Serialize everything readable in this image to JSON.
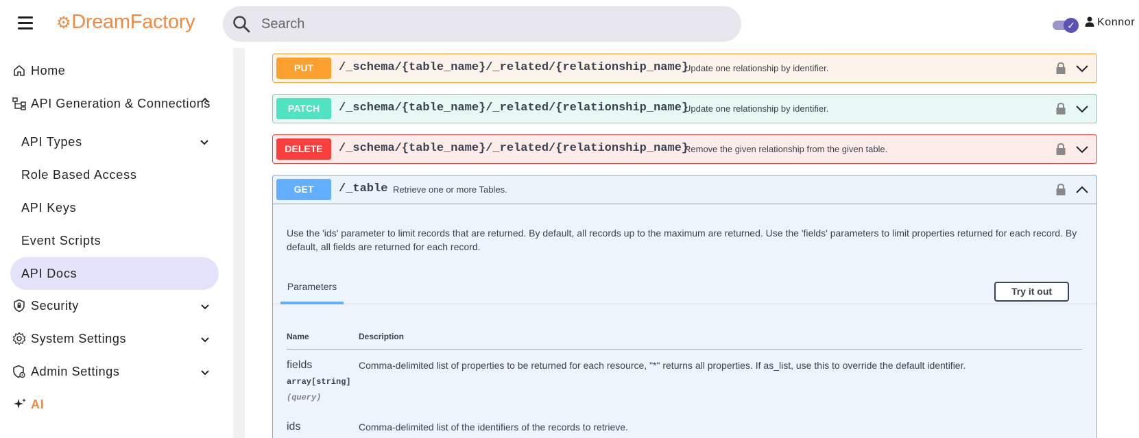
{
  "header": {
    "logo": "DreamFactory",
    "search_placeholder": "Search",
    "user_name": "Konnor"
  },
  "sidebar": {
    "items": [
      {
        "label": "Home"
      },
      {
        "label": "API Generation & Connections"
      },
      {
        "label": "API Types"
      },
      {
        "label": "Role Based Access"
      },
      {
        "label": "API Keys"
      },
      {
        "label": "Event Scripts"
      },
      {
        "label": "API Docs"
      },
      {
        "label": "Security"
      },
      {
        "label": "System Settings"
      },
      {
        "label": "Admin Settings"
      },
      {
        "label": "AI"
      }
    ]
  },
  "operations": [
    {
      "method": "PUT",
      "path": "/_schema/{table_name}/_related/{relationship_name}",
      "summary": "Update one relationship by identifier."
    },
    {
      "method": "PATCH",
      "path": "/_schema/{table_name}/_related/{relationship_name}",
      "summary": "Update one relationship by identifier."
    },
    {
      "method": "DELETE",
      "path": "/_schema/{table_name}/_related/{relationship_name}",
      "summary": "Remove the given relationship from the given table."
    },
    {
      "method": "GET",
      "path": "/_table",
      "summary": "Retrieve one or more Tables."
    }
  ],
  "expanded": {
    "description": "Use the 'ids' parameter to limit records that are returned. By default, all records up to the maximum are returned. Use the 'fields' parameters to limit properties returned for each record. By default, all fields are returned for each record.",
    "tab_label": "Parameters",
    "try_button": "Try it out",
    "col_name": "Name",
    "col_description": "Description",
    "params": [
      {
        "name": "fields",
        "type": "array[string]",
        "in": "(query)",
        "description": "Comma-delimited list of properties to be returned for each resource, \"*\" returns all properties. If as_list, use this to override the default identifier."
      },
      {
        "name": "ids",
        "type": "",
        "in": "",
        "description": "Comma-delimited list of the identifiers of the records to retrieve."
      }
    ]
  },
  "colors": {
    "brand": "#f08a42",
    "put": "#fca130",
    "patch": "#50e3c2",
    "delete": "#f93e3e",
    "get": "#61affe",
    "active_nav": "#e5e2fb"
  }
}
